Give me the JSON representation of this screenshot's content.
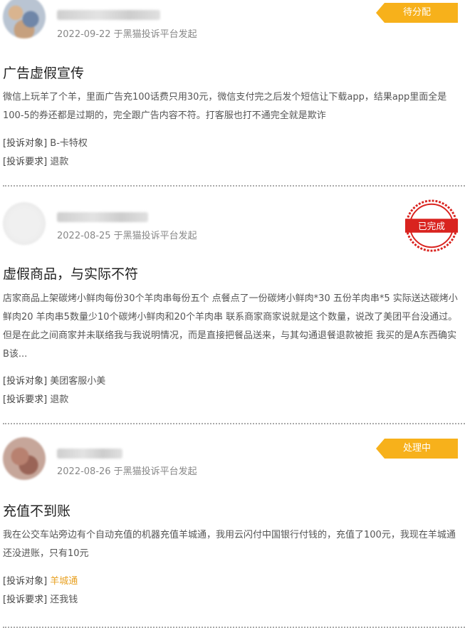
{
  "complaints": [
    {
      "status": "待分配",
      "status_color": "#f7b11b",
      "date_line": "2022-09-22 于黑猫投诉平台发起",
      "title": "广告虚假宣传",
      "description": "微信上玩羊了个羊，里面广告充100话费只用30元，微信支付完之后发个短信让下载app，结果app里面全是100-5的券还都是过期的，完全跟广告内容不符。打客服也打不通完全就是欺诈",
      "target_label": "[投诉对象]",
      "target_value": "B-卡特权",
      "demand_label": "[投诉要求]",
      "demand_value": "退款"
    },
    {
      "status": "已完成",
      "status_color": "#d9231f",
      "date_line": "2022-08-25 于黑猫投诉平台发起",
      "title": "虚假商品，与实际不符",
      "description": "店家商品上架碳烤小鲜肉每份30个羊肉串每份五个 点餐点了一份碳烤小鲜肉*30 五份羊肉串*5 实际送达碳烤小鲜肉20 羊肉串5数量少10个碳烤小鲜肉和20个羊肉串 联系商家商家说就是这个数量，说改了美团平台没通过。 但是在此之间商家并未联络我与我说明情况，而是直接把餐品送来，与其勾通退餐退款被拒 我买的是A东西确实B该...",
      "target_label": "[投诉对象]",
      "target_value": "美团客服小美",
      "demand_label": "[投诉要求]",
      "demand_value": "退款"
    },
    {
      "status": "处理中",
      "status_color": "#f7b11b",
      "date_line": "2022-08-26 于黑猫投诉平台发起",
      "title": "充值不到账",
      "description": "我在公交车站旁边有个自动充值的机器充值羊城通，我用云闪付中国银行付钱的，充值了100元，我现在羊城通还没进账，只有10元",
      "target_label": "[投诉对象]",
      "target_value": "羊城通",
      "target_value_color": "#e8a122",
      "demand_label": "[投诉要求]",
      "demand_value": "还我钱"
    }
  ]
}
